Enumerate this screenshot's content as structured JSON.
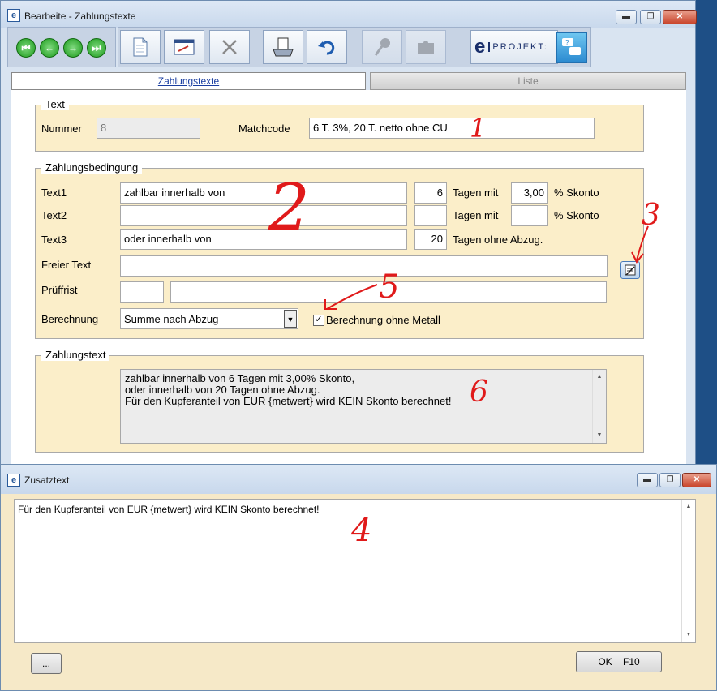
{
  "main_window": {
    "title": "Bearbeite - Zahlungstexte",
    "minimize": "▬",
    "maximize": "❐",
    "close": "✕"
  },
  "toolbar": {
    "nav": [
      "⏮",
      "←",
      "→",
      "⏭"
    ],
    "logo_letter": "e",
    "logo_text": "PROJEKT:"
  },
  "tabs": [
    {
      "label": "Zahlungstexte",
      "active": true
    },
    {
      "label": "Liste",
      "active": false
    }
  ],
  "text_group": {
    "legend": "Text",
    "nummer_label": "Nummer",
    "nummer_value": "8",
    "matchcode_label": "Matchcode",
    "matchcode_value": "6 T. 3%, 20 T. netto ohne CU"
  },
  "condition_group": {
    "legend": "Zahlungsbedingung",
    "rows": [
      {
        "label": "Text1",
        "text": "zahlbar innerhalb von",
        "days": "6",
        "days_label": "Tagen mit",
        "percent": "3,00",
        "percent_label": "% Skonto"
      },
      {
        "label": "Text2",
        "text": "",
        "days": "",
        "days_label": "Tagen mit",
        "percent": "",
        "percent_label": "% Skonto"
      },
      {
        "label": "Text3",
        "text": "oder innerhalb von",
        "days": "20",
        "days_label": "Tagen ohne Abzug."
      }
    ],
    "freier_text_label": "Freier Text",
    "freier_text_value": "",
    "prueffrist_label": "Prüffrist",
    "prueffrist_value": "",
    "prueffrist_text": "",
    "berechnung_label": "Berechnung",
    "berechnung_value": "Summe nach Abzug",
    "checkbox_label": "Berechnung ohne Metall",
    "checkbox_checked": true
  },
  "zahlungstext_group": {
    "legend": "Zahlungstext",
    "lines": [
      "zahlbar innerhalb von 6 Tagen mit 3,00% Skonto,",
      "oder innerhalb von 20 Tagen ohne Abzug.",
      "Für den Kupferanteil von EUR {metwert} wird KEIN Skonto berechnet!"
    ]
  },
  "zusatz_window": {
    "title": "Zusatztext",
    "text": "Für den Kupferanteil von EUR {metwert} wird KEIN Skonto berechnet!",
    "dots_button": "...",
    "ok_button": "OK    F10"
  },
  "annotations": [
    "1",
    "2",
    "3",
    "4",
    "5",
    "6"
  ],
  "colors": {
    "panel": "#fbeec9",
    "annotation": "#e01a1a",
    "dialog": "#f6e9c8"
  }
}
